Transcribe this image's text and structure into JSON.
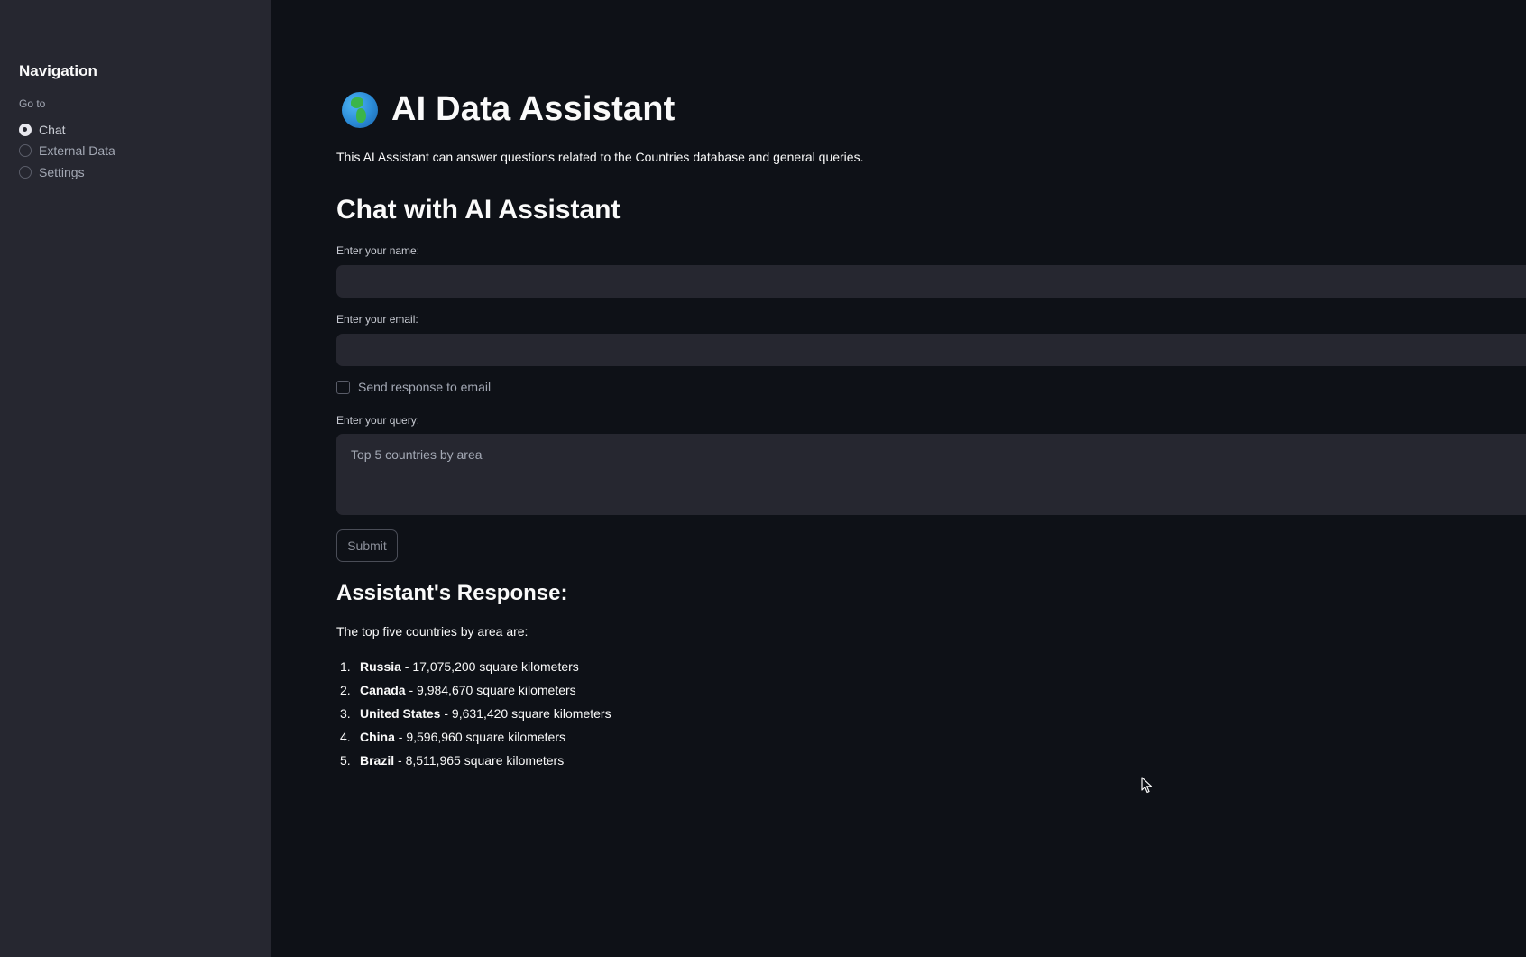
{
  "sidebar": {
    "title": "Navigation",
    "goto_label": "Go to",
    "options": [
      {
        "label": "Chat",
        "selected": true
      },
      {
        "label": "External Data",
        "selected": false
      },
      {
        "label": "Settings",
        "selected": false
      }
    ]
  },
  "header": {
    "icon": "globe-africa-icon",
    "title": "AI Data Assistant",
    "intro": "This AI Assistant can answer questions related to the Countries database and general queries."
  },
  "chat": {
    "title": "Chat with AI Assistant",
    "name_label": "Enter your name:",
    "name_value": "",
    "email_label": "Enter your email:",
    "email_value": "",
    "send_email_label": "Send response to email",
    "send_email_checked": false,
    "query_label": "Enter your query:",
    "query_placeholder": "Top 5 countries by area",
    "submit_label": "Submit"
  },
  "response": {
    "title": "Assistant's Response:",
    "intro": "The top five countries by area are:",
    "items": [
      {
        "num": "1.",
        "country": "Russia",
        "detail": " - 17,075,200 square kilometers"
      },
      {
        "num": "2.",
        "country": "Canada",
        "detail": " - 9,984,670 square kilometers"
      },
      {
        "num": "3.",
        "country": "United States",
        "detail": " - 9,631,420 square kilometers"
      },
      {
        "num": "4.",
        "country": "China",
        "detail": " - 9,596,960 square kilometers"
      },
      {
        "num": "5.",
        "country": "Brazil",
        "detail": " - 8,511,965 square kilometers"
      }
    ]
  },
  "colors": {
    "background": "#0e1117",
    "sidebar": "#262730",
    "input": "#262730",
    "text": "#fafafa"
  }
}
